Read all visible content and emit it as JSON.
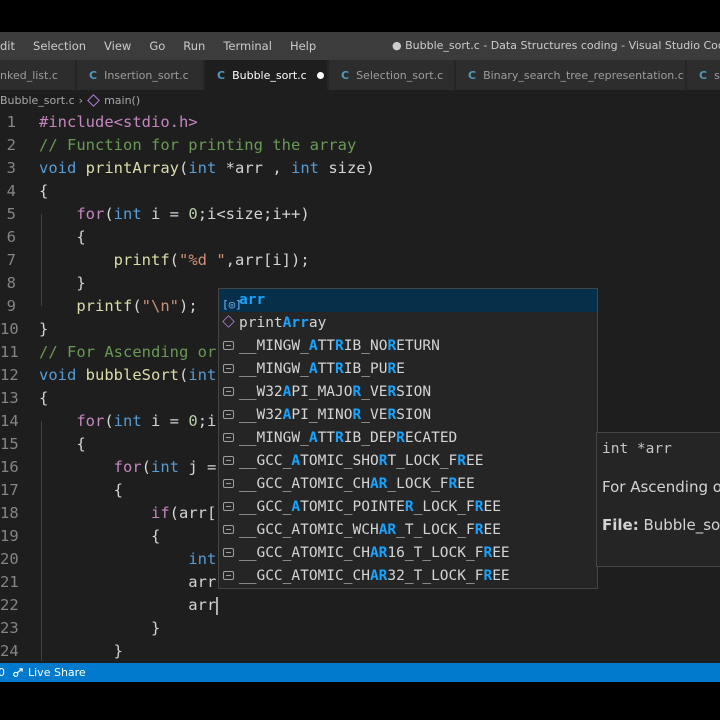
{
  "menu": [
    "dit",
    "Selection",
    "View",
    "Go",
    "Run",
    "Terminal",
    "Help"
  ],
  "window_title": "● Bubble_sort.c - Data Structures coding - Visual Studio Code",
  "tabs": [
    {
      "label": "nked_list.c",
      "icon": false
    },
    {
      "label": "Insertion_sort.c",
      "icon": true
    },
    {
      "label": "Bubble_sort.c",
      "icon": true,
      "active": true,
      "modified": true
    },
    {
      "label": "Selection_sort.c",
      "icon": true
    },
    {
      "label": "Binary_search_tree_representation.c",
      "icon": true
    },
    {
      "label": "s",
      "icon": true
    }
  ],
  "tab_icon_glyph": "C",
  "breadcrumb": {
    "file": "Bubble_sort.c",
    "separator": "›",
    "symbol": "main()"
  },
  "line_numbers": [
    "1",
    "2",
    "3",
    "4",
    "5",
    "6",
    "7",
    "8",
    "9",
    "10",
    "11",
    "12",
    "13",
    "14",
    "15",
    "16",
    "17",
    "18",
    "19",
    "20",
    "21",
    "22",
    "23",
    "24"
  ],
  "code_lines": [
    [
      [
        "#include<stdio.h>",
        "inc"
      ]
    ],
    [
      [
        "// Function for printing the array",
        "cm"
      ]
    ],
    [
      [
        "void ",
        "ty"
      ],
      [
        "printArray",
        "fn"
      ],
      [
        "(",
        ""
      ],
      [
        "int",
        "ty"
      ],
      [
        " *arr , ",
        ""
      ],
      [
        "int",
        "ty"
      ],
      [
        " size)",
        ""
      ]
    ],
    [
      [
        "{",
        ""
      ]
    ],
    [
      [
        "    ",
        ""
      ],
      [
        "for",
        "inc"
      ],
      [
        "(",
        ""
      ],
      [
        "int",
        "ty"
      ],
      [
        " i = ",
        ""
      ],
      [
        "0",
        "num"
      ],
      [
        ";i<size;i++)",
        ""
      ]
    ],
    [
      [
        "    {",
        ""
      ]
    ],
    [
      [
        "        ",
        ""
      ],
      [
        "printf",
        "fn"
      ],
      [
        "(",
        ""
      ],
      [
        "\"%d \"",
        "str"
      ],
      [
        ",arr[i]);",
        ""
      ]
    ],
    [
      [
        "    }",
        ""
      ]
    ],
    [
      [
        "    ",
        ""
      ],
      [
        "printf",
        "fn"
      ],
      [
        "(",
        ""
      ],
      [
        "\"\\n\"",
        "str"
      ],
      [
        ");",
        ""
      ]
    ],
    [
      [
        "}",
        ""
      ]
    ],
    [
      [
        "// For Ascending or",
        "cm"
      ]
    ],
    [
      [
        "void ",
        "ty"
      ],
      [
        "bubbleSort",
        "fn"
      ],
      [
        "(",
        ""
      ],
      [
        "int",
        "ty"
      ]
    ],
    [
      [
        "{",
        ""
      ]
    ],
    [
      [
        "    ",
        ""
      ],
      [
        "for",
        "inc"
      ],
      [
        "(",
        ""
      ],
      [
        "int",
        "ty"
      ],
      [
        " i = ",
        ""
      ],
      [
        "0",
        "num"
      ],
      [
        ";i",
        ""
      ]
    ],
    [
      [
        "    {",
        ""
      ]
    ],
    [
      [
        "        ",
        ""
      ],
      [
        "for",
        "inc"
      ],
      [
        "(",
        ""
      ],
      [
        "int",
        "ty"
      ],
      [
        " j =",
        ""
      ]
    ],
    [
      [
        "        {",
        ""
      ]
    ],
    [
      [
        "            ",
        ""
      ],
      [
        "if",
        "inc"
      ],
      [
        "(arr[",
        ""
      ]
    ],
    [
      [
        "            {",
        ""
      ]
    ],
    [
      [
        "                ",
        ""
      ],
      [
        "int",
        "ty"
      ]
    ],
    [
      [
        "                arr",
        ""
      ]
    ],
    [
      [
        "                arr",
        ""
      ]
    ],
    [
      [
        "            }",
        ""
      ]
    ],
    [
      [
        "        }",
        ""
      ]
    ]
  ],
  "suggestions": [
    {
      "parts": [
        [
          "arr",
          true
        ]
      ],
      "kind": "variable",
      "selected": true
    },
    {
      "parts": [
        [
          "print",
          false
        ],
        [
          "Arr",
          true
        ],
        [
          "ay",
          false
        ]
      ],
      "kind": "method"
    },
    {
      "parts": [
        [
          "__MINGW_",
          false
        ],
        [
          "A",
          true
        ],
        [
          "TT",
          false
        ],
        [
          "R",
          true
        ],
        [
          "IB_NO",
          false
        ],
        [
          "R",
          true
        ],
        [
          "ETURN",
          false
        ]
      ],
      "kind": "text"
    },
    {
      "parts": [
        [
          "__MINGW_",
          false
        ],
        [
          "A",
          true
        ],
        [
          "TT",
          false
        ],
        [
          "R",
          true
        ],
        [
          "IB_PU",
          false
        ],
        [
          "R",
          true
        ],
        [
          "E",
          false
        ]
      ],
      "kind": "text"
    },
    {
      "parts": [
        [
          "__W32",
          false
        ],
        [
          "A",
          true
        ],
        [
          "PI_MAJO",
          false
        ],
        [
          "R",
          true
        ],
        [
          "_VE",
          false
        ],
        [
          "R",
          true
        ],
        [
          "SION",
          false
        ]
      ],
      "kind": "text"
    },
    {
      "parts": [
        [
          "__W32",
          false
        ],
        [
          "A",
          true
        ],
        [
          "PI_MINO",
          false
        ],
        [
          "R",
          true
        ],
        [
          "_VE",
          false
        ],
        [
          "R",
          true
        ],
        [
          "SION",
          false
        ]
      ],
      "kind": "text"
    },
    {
      "parts": [
        [
          "__MINGW_",
          false
        ],
        [
          "A",
          true
        ],
        [
          "TT",
          false
        ],
        [
          "R",
          true
        ],
        [
          "IB_DEP",
          false
        ],
        [
          "R",
          true
        ],
        [
          "ECATED",
          false
        ]
      ],
      "kind": "text"
    },
    {
      "parts": [
        [
          "__GCC_",
          false
        ],
        [
          "A",
          true
        ],
        [
          "TOMIC_SHO",
          false
        ],
        [
          "R",
          true
        ],
        [
          "T_LOCK_F",
          false
        ],
        [
          "R",
          true
        ],
        [
          "EE",
          false
        ]
      ],
      "kind": "text"
    },
    {
      "parts": [
        [
          "__GCC_ATOMIC_CH",
          false
        ],
        [
          "AR",
          true
        ],
        [
          "_LOCK_F",
          false
        ],
        [
          "R",
          true
        ],
        [
          "EE",
          false
        ]
      ],
      "kind": "text"
    },
    {
      "parts": [
        [
          "__GCC_",
          false
        ],
        [
          "A",
          true
        ],
        [
          "TOMIC_POINTE",
          false
        ],
        [
          "R",
          true
        ],
        [
          "_LOCK_F",
          false
        ],
        [
          "R",
          true
        ],
        [
          "EE",
          false
        ]
      ],
      "kind": "text"
    },
    {
      "parts": [
        [
          "__GCC_ATOMIC_WCH",
          false
        ],
        [
          "AR",
          true
        ],
        [
          "_T_LOCK_F",
          false
        ],
        [
          "R",
          true
        ],
        [
          "EE",
          false
        ]
      ],
      "kind": "text"
    },
    {
      "parts": [
        [
          "__GCC_ATOMIC_CH",
          false
        ],
        [
          "AR",
          true
        ],
        [
          "16_T_LOCK_F",
          false
        ],
        [
          "R",
          true
        ],
        [
          "EE",
          false
        ]
      ],
      "kind": "text"
    },
    {
      "parts": [
        [
          "__GCC_ATOMIC_CH",
          false
        ],
        [
          "AR",
          true
        ],
        [
          "32_T_LOCK_F",
          false
        ],
        [
          "R",
          true
        ],
        [
          "EE",
          false
        ]
      ],
      "kind": "text"
    }
  ],
  "details": {
    "signature": "int *arr",
    "doc": "For Ascending o",
    "file_label": "File:",
    "file_value": " Bubble_sor"
  },
  "status": {
    "icon": "live-share-icon",
    "text": "Live Share",
    "left_stub": "0"
  },
  "colors": {
    "status_bar": "#007acc",
    "highlight": "#18a3ff",
    "editor_bg": "#1e1e1e"
  }
}
